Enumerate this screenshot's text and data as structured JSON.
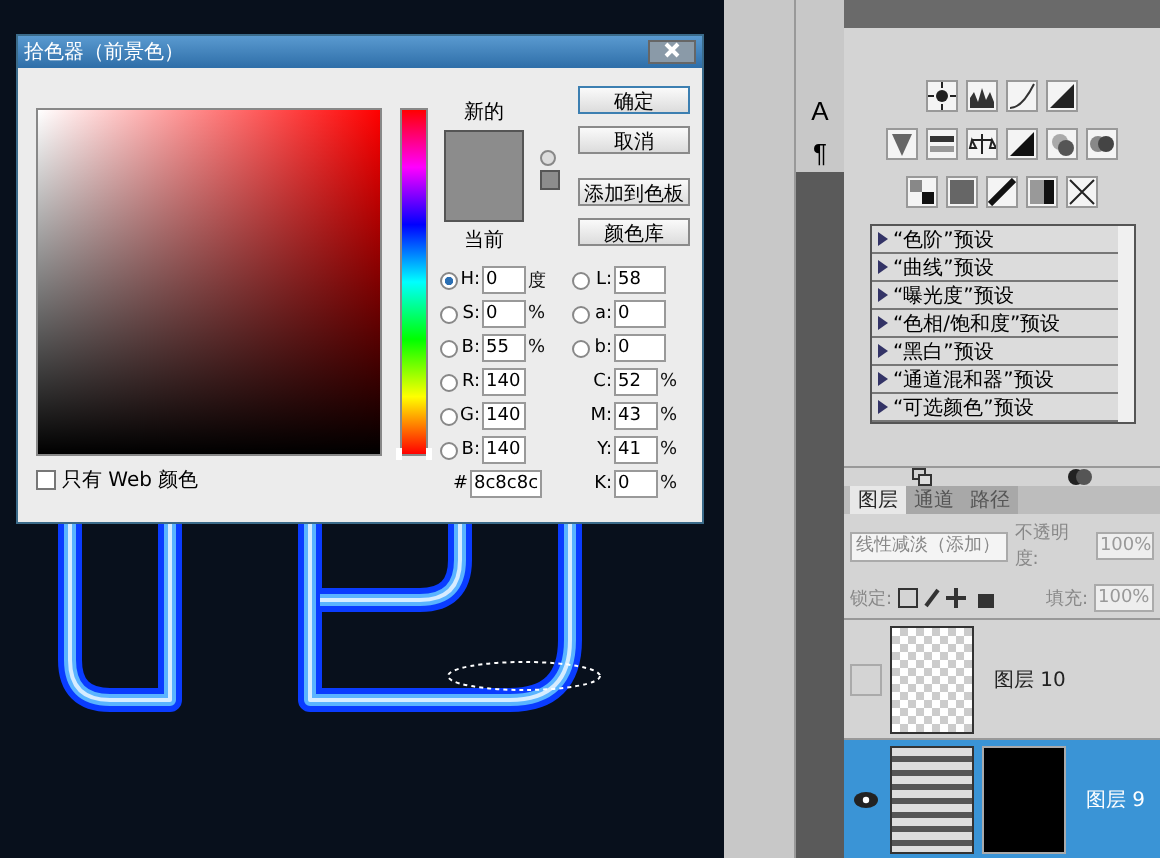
{
  "dialog": {
    "title": "拾色器（前景色）",
    "new_label": "新的",
    "current_label": "当前",
    "buttons": [
      {
        "label": "确定",
        "default": true
      },
      {
        "label": "取消",
        "default": false
      },
      {
        "label": "添加到色板",
        "default": false
      },
      {
        "label": "颜色库",
        "default": false
      }
    ],
    "left_fields": [
      {
        "kind": "radio",
        "label": "H:",
        "value": "0",
        "unit": "度",
        "selected": true
      },
      {
        "kind": "radio",
        "label": "S:",
        "value": "0",
        "unit": "%",
        "selected": false
      },
      {
        "kind": "radio",
        "label": "B:",
        "value": "55",
        "unit": "%",
        "selected": false
      },
      {
        "kind": "radio",
        "label": "R:",
        "value": "140",
        "selected": false
      },
      {
        "kind": "radio",
        "label": "G:",
        "value": "140",
        "selected": false
      },
      {
        "kind": "radio",
        "label": "B:",
        "value": "140",
        "selected": false
      },
      {
        "kind": "plain",
        "label": "#",
        "value": "8c8c8c"
      }
    ],
    "right_fields": [
      {
        "kind": "radio",
        "label": "L:",
        "value": "58",
        "selected": false
      },
      {
        "kind": "radio",
        "label": "a:",
        "value": "0",
        "selected": false
      },
      {
        "kind": "radio",
        "label": "b:",
        "value": "0",
        "selected": false
      },
      {
        "kind": "plain",
        "label": "C:",
        "value": "52",
        "unit": "%"
      },
      {
        "kind": "plain",
        "label": "M:",
        "value": "43",
        "unit": "%"
      },
      {
        "kind": "plain",
        "label": "Y:",
        "value": "41",
        "unit": "%"
      },
      {
        "kind": "plain",
        "label": "K:",
        "value": "0",
        "unit": "%"
      }
    ],
    "web_only": {
      "label": "只有 Web 颜色",
      "checked": false
    },
    "hue": {
      "level": 0
    }
  },
  "tools": [
    {
      "label": "A"
    },
    {
      "label": "¶"
    }
  ],
  "adjustments": {
    "presets": [
      "“色阶”预设",
      "“曲线”预设",
      "“曝光度”预设",
      "“色相/饱和度”预设",
      "“黑白”预设",
      "“通道混和器”预设",
      "“可选颜色”预设"
    ]
  },
  "layers_panel": {
    "tabs": [
      {
        "label": "图层",
        "selected": true
      },
      {
        "label": "通道",
        "selected": false
      },
      {
        "label": "路径",
        "selected": false
      }
    ],
    "blend_mode": "线性减淡（添加）",
    "opacity_label": "不透明度:",
    "opacity": "100%",
    "lock_label": "锁定:",
    "fill_label": "填充:",
    "fill": "100%",
    "layers": [
      {
        "name": "图层 10",
        "visible": false,
        "selected": false,
        "kind": "empty"
      },
      {
        "name": "图层 9",
        "visible": true,
        "selected": true,
        "kind": "masked"
      }
    ]
  }
}
